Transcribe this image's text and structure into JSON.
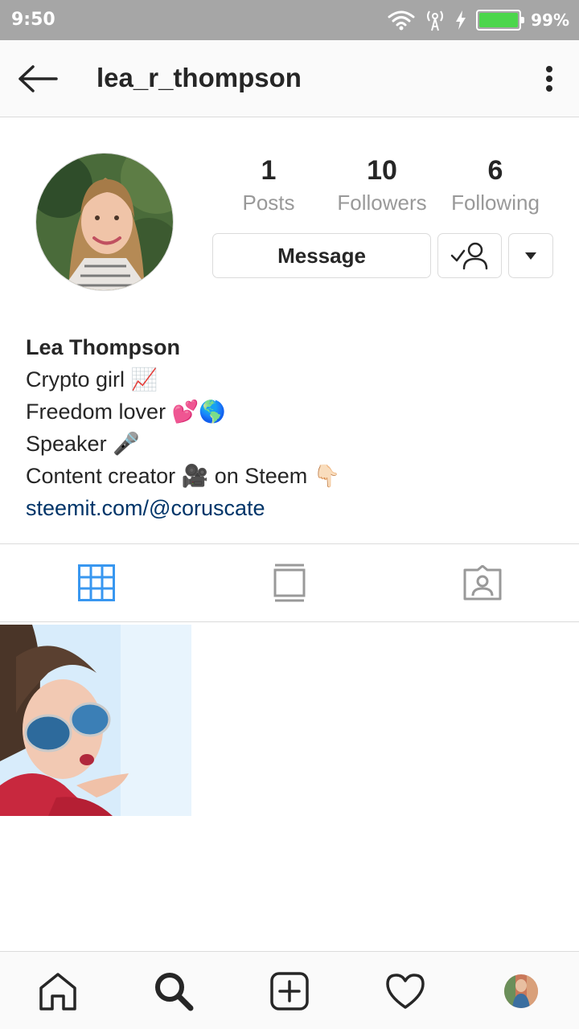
{
  "status_bar": {
    "time": "9:50",
    "battery": "99%",
    "battery_level": 0.99
  },
  "header": {
    "username": "lea_r_thompson"
  },
  "profile": {
    "stats": [
      {
        "value": "1",
        "label": "Posts"
      },
      {
        "value": "10",
        "label": "Followers"
      },
      {
        "value": "6",
        "label": "Following"
      }
    ],
    "message_label": "Message"
  },
  "bio": {
    "name": "Lea Thompson",
    "lines": [
      "Crypto girl 📈",
      "Freedom lover 💕🌎",
      "Speaker 🎤",
      "Content creator 🎥 on Steem 👇🏻"
    ],
    "link": "steemit.com/@coruscate"
  },
  "colors": {
    "accent": "#3897f0",
    "link": "#003569",
    "muted": "#999999",
    "border": "#dbdbdb"
  },
  "icons": {
    "tabs": [
      "grid-icon",
      "feed-icon",
      "tagged-icon"
    ],
    "nav": [
      "home-icon",
      "search-icon",
      "add-post-icon",
      "heart-icon",
      "profile-avatar"
    ]
  }
}
